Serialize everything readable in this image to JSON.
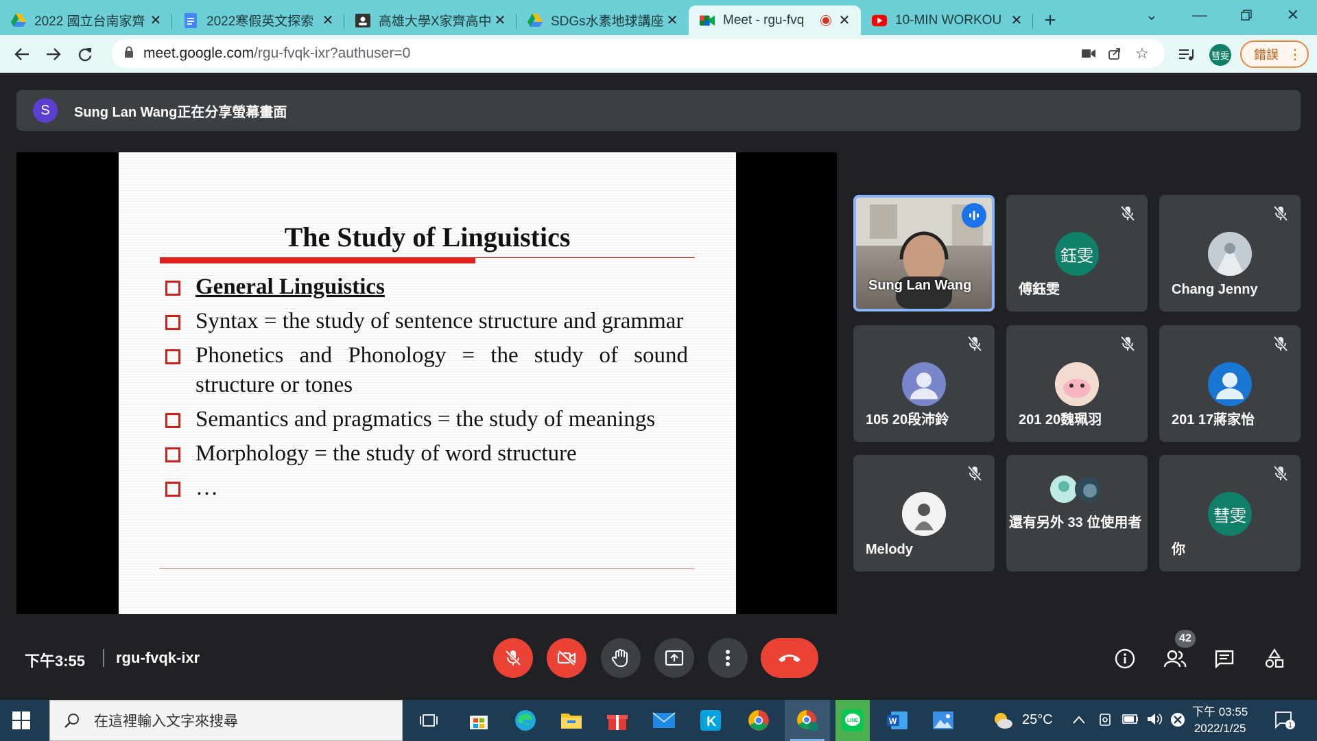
{
  "browser": {
    "tabs": [
      {
        "title": "2022 國立台南家齊",
        "favicon": "google-drive-icon"
      },
      {
        "title": "2022寒假英文探索",
        "favicon": "google-docs-icon"
      },
      {
        "title": "高雄大學X家齊高中",
        "favicon": "classroom-icon"
      },
      {
        "title": "SDGs水素地球講座",
        "favicon": "google-drive-icon"
      },
      {
        "title": "Meet - rgu-fvq",
        "favicon": "google-meet-icon",
        "active": true
      },
      {
        "title": "10-MIN WORKOU",
        "favicon": "youtube-icon"
      }
    ],
    "url_host": "meet.google.com",
    "url_path": "/rgu-fvqk-ixr?authuser=0",
    "profile_initials": "彗雯",
    "error_label": "錯誤"
  },
  "meet": {
    "presenter_initial": "S",
    "banner_text": "Sung Lan Wang正在分享螢幕畫面",
    "slide": {
      "title": "The Study of Linguistics",
      "items": [
        "General Linguistics",
        "Syntax = the study of sentence structure and grammar",
        "Phonetics and Phonology = the study of sound structure or tones",
        "Semantics and pragmatics = the study of meanings",
        "Morphology = the study of word structure",
        "…"
      ]
    },
    "participants": [
      {
        "name": "Sung Lan Wang",
        "avatar": "",
        "color": "#8e8e8e"
      },
      {
        "name": "傅鈺雯",
        "avatar": "鈺雯",
        "color": "#11806a"
      },
      {
        "name": "Chang Jenny",
        "avatar": "",
        "color": "#9aa7b2"
      },
      {
        "name": "105 20段沛鈴",
        "avatar": "",
        "color": "#7986cb"
      },
      {
        "name": "201 20魏珮羽",
        "avatar": "",
        "color": "#e9c8b8"
      },
      {
        "name": "201 17蔣家怡",
        "avatar": "",
        "color": "#1976d2"
      },
      {
        "name": "Melody",
        "avatar": "",
        "color": "#e8e8e8"
      },
      {
        "name": "還有另外 33 位使用者",
        "avatar": "",
        "color": "#3c4043"
      },
      {
        "name": "你",
        "avatar": "彗雯",
        "color": "#11806a"
      }
    ],
    "time": "下午3:55",
    "meeting_code": "rgu-fvqk-ixr",
    "participant_count": "42"
  },
  "taskbar": {
    "search_placeholder": "在這裡輸入文字來搜尋",
    "weather": "25°C",
    "time": "下午 03:55",
    "date": "2022/1/25",
    "notification_count": "1"
  }
}
